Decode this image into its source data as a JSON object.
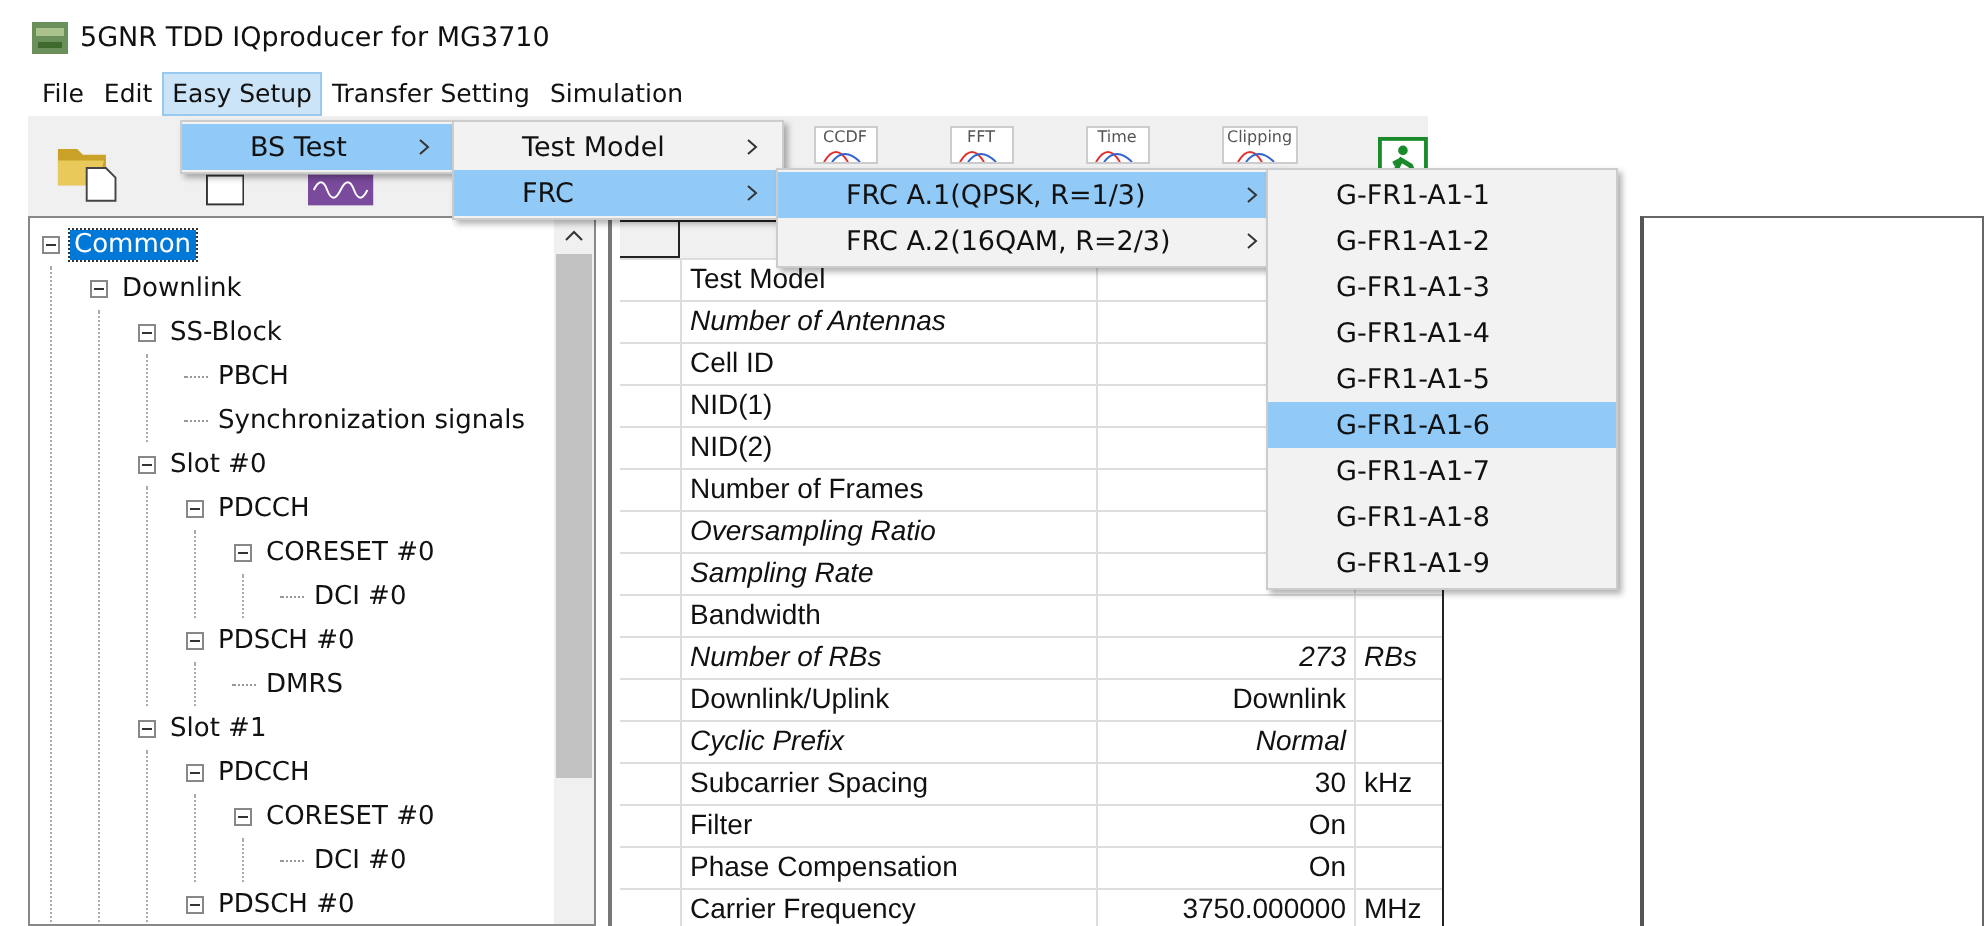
{
  "window": {
    "title": "5GNR TDD IQproducer for MG3710"
  },
  "menu_bar": [
    {
      "label": "File",
      "selected": false
    },
    {
      "label": "Edit",
      "selected": false
    },
    {
      "label": "Easy Setup",
      "selected": true
    },
    {
      "label": "Transfer Setting",
      "selected": false
    },
    {
      "label": "Simulation",
      "selected": false
    }
  ],
  "toolbar": [
    {
      "kind": "folder"
    },
    {
      "kind": "blank"
    },
    {
      "kind": "wave"
    },
    {
      "kind": "graph",
      "label": "CCDF"
    },
    {
      "kind": "graph",
      "label": "FFT"
    },
    {
      "kind": "graph",
      "label": "Time"
    },
    {
      "kind": "graph",
      "label": "Clipping"
    },
    {
      "kind": "exit"
    }
  ],
  "menus": [
    {
      "items": [
        {
          "label": "BS Test",
          "submenu": true,
          "selected": true
        }
      ]
    },
    {
      "items": [
        {
          "label": "Test Model",
          "submenu": true,
          "selected": false
        },
        {
          "label": "FRC",
          "submenu": true,
          "selected": true
        }
      ]
    },
    {
      "items": [
        {
          "label": "FRC A.1(QPSK, R=1/3)",
          "submenu": true,
          "selected": true
        },
        {
          "label": "FRC A.2(16QAM, R=2/3)",
          "submenu": true,
          "selected": false
        }
      ]
    },
    {
      "items": [
        {
          "label": "G-FR1-A1-1",
          "submenu": false,
          "selected": false
        },
        {
          "label": "G-FR1-A1-2",
          "submenu": false,
          "selected": false
        },
        {
          "label": "G-FR1-A1-3",
          "submenu": false,
          "selected": false
        },
        {
          "label": "G-FR1-A1-4",
          "submenu": false,
          "selected": false
        },
        {
          "label": "G-FR1-A1-5",
          "submenu": false,
          "selected": false
        },
        {
          "label": "G-FR1-A1-6",
          "submenu": false,
          "selected": true
        },
        {
          "label": "G-FR1-A1-7",
          "submenu": false,
          "selected": false
        },
        {
          "label": "G-FR1-A1-8",
          "submenu": false,
          "selected": false
        },
        {
          "label": "G-FR1-A1-9",
          "submenu": false,
          "selected": false
        }
      ]
    }
  ],
  "tree": [
    {
      "label": "Common",
      "selected": true,
      "expanded": true,
      "children": [
        {
          "label": "Downlink",
          "selected": false,
          "expanded": true,
          "children": [
            {
              "label": "SS-Block",
              "selected": false,
              "expanded": true,
              "children": [
                {
                  "label": "PBCH",
                  "selected": false
                },
                {
                  "label": "Synchronization signals",
                  "selected": false
                }
              ]
            },
            {
              "label": "Slot #0",
              "selected": false,
              "expanded": true,
              "children": [
                {
                  "label": "PDCCH",
                  "selected": false,
                  "expanded": true,
                  "children": [
                    {
                      "label": "CORESET #0",
                      "selected": false,
                      "expanded": true,
                      "children": [
                        {
                          "label": "DCI #0",
                          "selected": false
                        }
                      ]
                    }
                  ]
                },
                {
                  "label": "PDSCH #0",
                  "selected": false,
                  "expanded": true,
                  "children": [
                    {
                      "label": "DMRS",
                      "selected": false
                    }
                  ]
                }
              ]
            },
            {
              "label": "Slot #1",
              "selected": false,
              "expanded": true,
              "children": [
                {
                  "label": "PDCCH",
                  "selected": false,
                  "expanded": true,
                  "children": [
                    {
                      "label": "CORESET #0",
                      "selected": false,
                      "expanded": true,
                      "children": [
                        {
                          "label": "DCI #0",
                          "selected": false
                        }
                      ]
                    }
                  ]
                },
                {
                  "label": "PDSCH #0",
                  "selected": false,
                  "expanded": true
                }
              ]
            }
          ]
        }
      ]
    }
  ],
  "table": {
    "rows": [
      {
        "name": "Test Model",
        "italic": false
      },
      {
        "name": "Number of Antennas",
        "italic": true
      },
      {
        "name": "Cell ID",
        "italic": false
      },
      {
        "name": "NID(1)",
        "italic": false
      },
      {
        "name": "NID(2)",
        "italic": false
      },
      {
        "name": "Number of Frames",
        "italic": false
      },
      {
        "name": "Oversampling Ratio",
        "italic": true
      },
      {
        "name": "Sampling Rate",
        "italic": true
      },
      {
        "name": "Bandwidth",
        "italic": false
      },
      {
        "name": "Number of RBs",
        "italic": true,
        "value": "273",
        "unit": "RBs"
      },
      {
        "name": "Downlink/Uplink",
        "italic": false,
        "value": "Downlink"
      },
      {
        "name": "Cyclic Prefix",
        "italic": true,
        "value": "Normal"
      },
      {
        "name": "Subcarrier Spacing",
        "italic": false,
        "value": "30",
        "unit": "kHz"
      },
      {
        "name": "Filter",
        "italic": false,
        "value": "On"
      },
      {
        "name": "Phase Compensation",
        "italic": false,
        "value": "On"
      },
      {
        "name": "Carrier Frequency",
        "italic": false,
        "value": "3750.000000",
        "unit": "MHz"
      }
    ]
  }
}
